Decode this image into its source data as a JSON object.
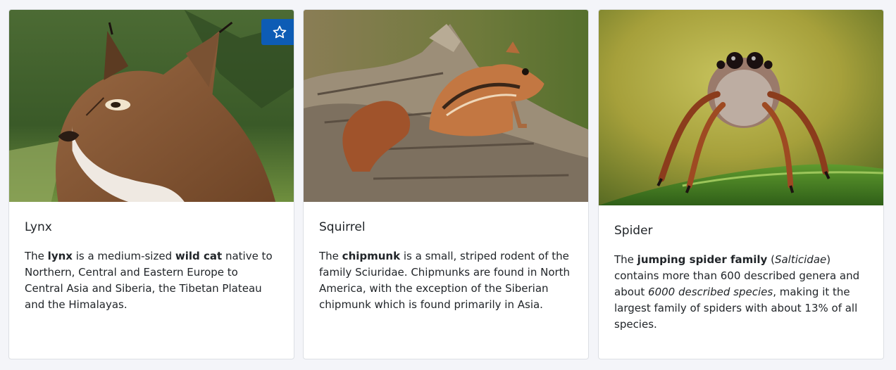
{
  "cards": [
    {
      "title": "Lynx",
      "image_subject": "lynx",
      "favorite_icon": "star-outline-icon",
      "favorite_color": "#0d5cb5",
      "text": {
        "t1": "The ",
        "b1": "lynx",
        "t2": " is a medium-sized ",
        "b2": "wild cat",
        "t3": " native to Northern, Central and Eastern Europe to Central Asia and Siberia, the Tibetan Plateau and the Himalayas."
      }
    },
    {
      "title": "Squirrel",
      "image_subject": "chipmunk",
      "text": {
        "t1": "The ",
        "b1": "chipmunk",
        "t2": " is a small, striped rodent of the family Sciuridae. Chipmunks are found in North America, with the exception of the Siberian chipmunk which is found primarily in Asia."
      }
    },
    {
      "title": "Spider",
      "image_subject": "jumping spider",
      "text": {
        "t1": "The ",
        "b1": "jumping spider family",
        "t2": " (",
        "i1": "Salticidae",
        "t3": ") contains more than 600 described genera and about ",
        "i2": "6000 described species",
        "t4": ", making it the largest family of spiders with about 13% of all species."
      }
    }
  ]
}
